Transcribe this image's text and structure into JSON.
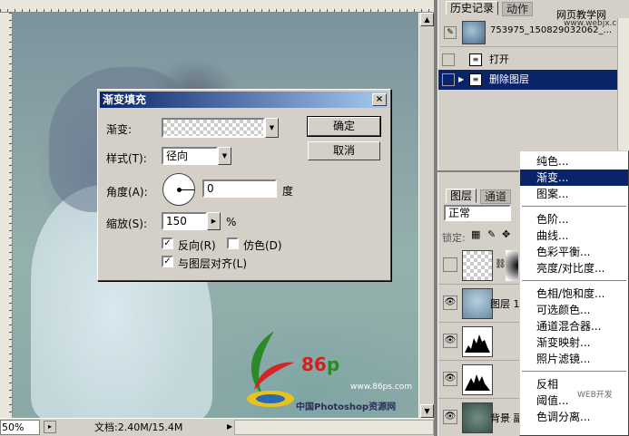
{
  "canvas_window": {
    "zoom": "50%",
    "doc_size": "文档:2.40M/15.4M"
  },
  "watermark": {
    "logo_number": "86",
    "logo_letter": "p",
    "url": "www.86ps.com",
    "site_name": "中国Photoshop资源网"
  },
  "dialog": {
    "title": "渐变填充",
    "close": "×",
    "gradient_label": "渐变:",
    "style_label": "样式(T):",
    "style_value": "径向",
    "angle_label": "角度(A):",
    "angle_value": "0",
    "angle_unit": "度",
    "scale_label": "缩放(S):",
    "scale_value": "150",
    "scale_unit": "%",
    "reverse_label": "反向(R)",
    "reverse_checked": true,
    "dither_label": "仿色(D)",
    "dither_checked": false,
    "align_label": "与图层对齐(L)",
    "align_checked": true,
    "ok_label": "确定",
    "cancel_label": "取消"
  },
  "history_panel": {
    "tabs": [
      "历史记录",
      "动作"
    ],
    "snapshot_name": "753975_150829032062_...",
    "items": [
      {
        "label": "打开",
        "selected": false
      },
      {
        "label": "删除图层",
        "selected": true
      }
    ],
    "site_tag": "网页教学网",
    "site_sub": "www.webjx.com"
  },
  "layers_panel": {
    "tabs": [
      "图层",
      "通道"
    ],
    "blend_mode": "正常",
    "lock_label": "锁定:",
    "layers": [
      {
        "name": "",
        "visible": false
      },
      {
        "name": "图层 1",
        "visible": true
      },
      {
        "name": "",
        "visible": true
      },
      {
        "name": "",
        "visible": true
      },
      {
        "name": "背景 副",
        "visible": true
      }
    ]
  },
  "context_menu": {
    "items": [
      {
        "label": "纯色...",
        "highlighted": false
      },
      {
        "label": "渐变...",
        "highlighted": true
      },
      {
        "label": "图案...",
        "highlighted": false
      },
      {
        "separator": true
      },
      {
        "label": "色阶...",
        "highlighted": false
      },
      {
        "label": "曲线...",
        "highlighted": false
      },
      {
        "label": "色彩平衡...",
        "highlighted": false
      },
      {
        "label": "亮度/对比度...",
        "highlighted": false
      },
      {
        "separator": true
      },
      {
        "label": "色相/饱和度...",
        "highlighted": false
      },
      {
        "label": "可选颜色...",
        "highlighted": false
      },
      {
        "label": "通道混合器...",
        "highlighted": false
      },
      {
        "label": "渐变映射...",
        "highlighted": false
      },
      {
        "label": "照片滤镜...",
        "highlighted": false
      },
      {
        "separator": true
      },
      {
        "label": "反相",
        "highlighted": false
      },
      {
        "label": "阈值...",
        "highlighted": false
      },
      {
        "label": "色调分离...",
        "highlighted": false
      }
    ]
  },
  "corner_mark": "WEB开发"
}
